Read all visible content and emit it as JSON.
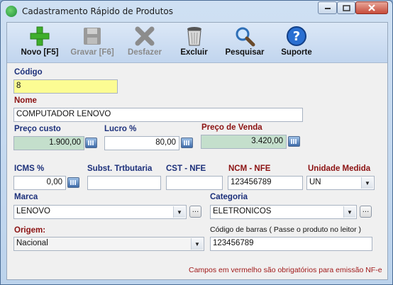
{
  "window": {
    "title": "Cadastramento Rápido de Produtos"
  },
  "toolbar": {
    "buttons": [
      {
        "label": "Novo [F5]",
        "icon": "plus-icon",
        "enabled": true
      },
      {
        "label": "Gravar [F6]",
        "icon": "save-disk-icon",
        "enabled": false
      },
      {
        "label": "Desfazer",
        "icon": "x-cancel-icon",
        "enabled": false
      },
      {
        "label": "Excluir",
        "icon": "trash-can-icon",
        "enabled": true
      },
      {
        "label": "Pesquisar",
        "icon": "magnifier-icon",
        "enabled": true
      },
      {
        "label": "Suporte",
        "icon": "help-icon",
        "enabled": true
      }
    ]
  },
  "form": {
    "codigo": {
      "label": "Código",
      "value": "8"
    },
    "nome": {
      "label": "Nome",
      "value": "COMPUTADOR LENOVO"
    },
    "preco_custo": {
      "label": "Preço custo",
      "value": "1.900,00"
    },
    "lucro": {
      "label": "Lucro %",
      "value": "80,00"
    },
    "preco_venda": {
      "label": "Preço de Venda",
      "value": "3.420,00"
    },
    "icms": {
      "label": "ICMS %",
      "value": "0,00"
    },
    "subst": {
      "label": "Subst. Trtbutaria",
      "value": ""
    },
    "cst": {
      "label": "CST - NFE",
      "value": ""
    },
    "ncm": {
      "label": "NCM - NFE",
      "value": "123456789"
    },
    "unidade": {
      "label": "Unidade Medida",
      "value": "UN"
    },
    "marca": {
      "label": "Marca",
      "value": "LENOVO"
    },
    "categoria": {
      "label": "Categoria",
      "value": "ELETRONICOS"
    },
    "origem": {
      "label": "Origem:",
      "value": "Nacional"
    },
    "codigo_barras": {
      "label": "Código de barras ( Passe o produto no leitor )",
      "value": "123456789"
    }
  },
  "footnote": "Campos em vermelho são obrigatórios para emissão NF-e",
  "colors": {
    "required_label": "#8b1111",
    "normal_label": "#1b2f7a",
    "codigo_bg": "#fcfc93",
    "price_bg": "#c4dfcc"
  }
}
